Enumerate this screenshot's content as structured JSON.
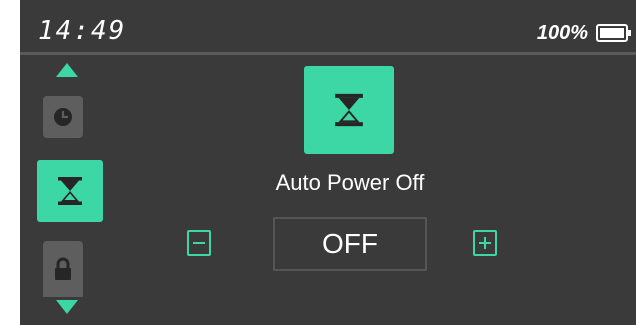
{
  "status_bar": {
    "time": "14:49",
    "battery_percent_text": "100%",
    "battery_level": 1.0
  },
  "sidebar": {
    "items": [
      {
        "name": "clock",
        "icon": "clock-icon",
        "active": false
      },
      {
        "name": "auto-power-off",
        "icon": "hourglass-icon",
        "active": true
      },
      {
        "name": "lock",
        "icon": "lock-icon",
        "active": false
      }
    ],
    "up_arrow_icon": "triangle-up-icon",
    "down_arrow_icon": "triangle-down-icon"
  },
  "setting": {
    "icon": "hourglass-icon",
    "title": "Auto Power Off",
    "value": "OFF",
    "decrease_icon": "minus-icon",
    "increase_icon": "plus-icon"
  },
  "colors": {
    "accent": "#3dd6a5",
    "background": "#3a3a3a",
    "inactive_tile": "#5e5e5e",
    "divider": "#5a5a5a",
    "text": "#ffffff"
  }
}
